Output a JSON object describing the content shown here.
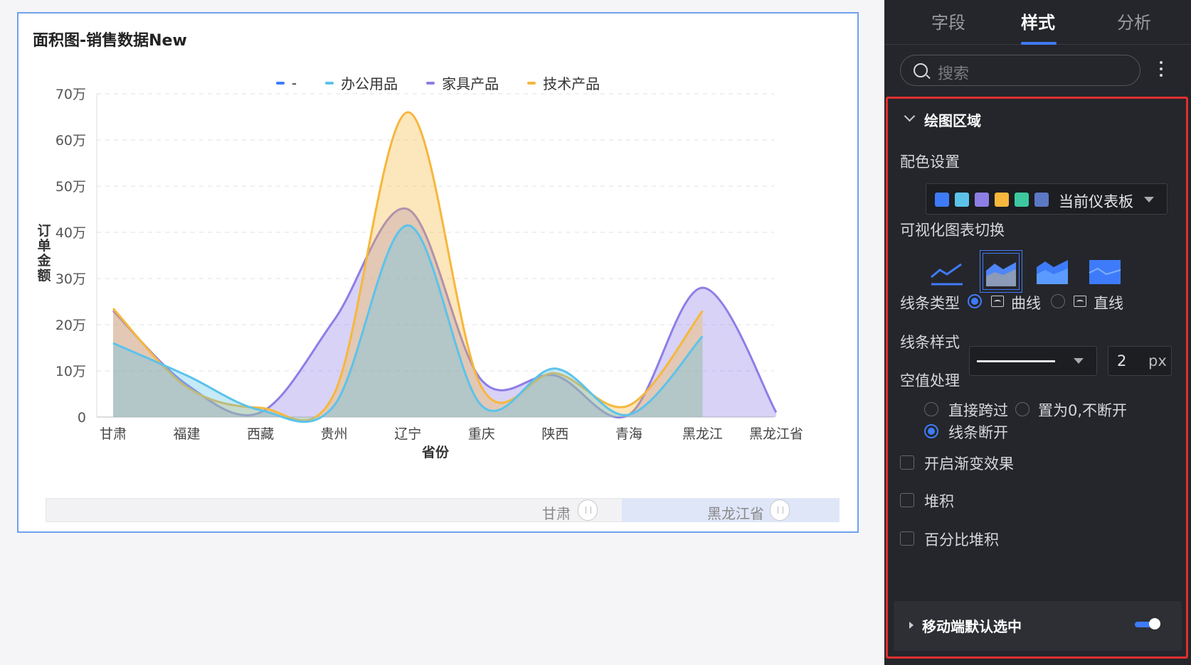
{
  "card": {
    "title": "面积图-销售数据New"
  },
  "legend": [
    {
      "label": "-",
      "color": "#3e7bfa"
    },
    {
      "label": "办公用品",
      "color": "#5bc3ea"
    },
    {
      "label": "家具产品",
      "color": "#8d7ee6"
    },
    {
      "label": "技术产品",
      "color": "#f6b73c"
    }
  ],
  "chart_data": {
    "type": "area",
    "title": "面积图-销售数据New",
    "xlabel": "省份",
    "ylabel": "订单金额",
    "categories": [
      "甘肃",
      "福建",
      "西藏",
      "贵州",
      "辽宁",
      "重庆",
      "陕西",
      "青海",
      "黑龙江",
      "黑龙江省"
    ],
    "y_ticks": [
      "0",
      "10万",
      "20万",
      "30万",
      "40万",
      "50万",
      "60万",
      "70万"
    ],
    "ylim": [
      0,
      700000
    ],
    "grid": true,
    "legend_position": "top",
    "series": [
      {
        "name": "办公用品",
        "color": "#5bc3ea",
        "values": [
          160000,
          90000,
          15000,
          25000,
          415000,
          25000,
          105000,
          5000,
          175000,
          null
        ]
      },
      {
        "name": "家具产品",
        "color": "#8d7ee6",
        "values": [
          230000,
          70000,
          10000,
          210000,
          450000,
          80000,
          90000,
          5000,
          280000,
          10000
        ]
      },
      {
        "name": "技术产品",
        "color": "#f6b73c",
        "values": [
          235000,
          65000,
          20000,
          50000,
          660000,
          65000,
          95000,
          25000,
          230000,
          null
        ]
      }
    ]
  },
  "slider": {
    "start_label": "甘肃",
    "end_label": "黑龙江省"
  },
  "panel": {
    "tabs": [
      "字段",
      "样式",
      "分析"
    ],
    "active_tab": "样式",
    "search_placeholder": "搜索",
    "section_title": "绘图区域",
    "color_label": "配色设置",
    "palette": [
      "#3e7bfa",
      "#5bc3ea",
      "#8d7ee6",
      "#f6b73c",
      "#3cc9a0",
      "#5b78c4"
    ],
    "palette_name": "当前仪表板",
    "switch_label": "可视化图表切换",
    "line_type_label": "线条类型",
    "curve_label": "曲线",
    "straight_label": "直线",
    "line_style_label": "线条样式",
    "line_width": "2",
    "line_width_unit": "px",
    "null_label": "空值处理",
    "null_skip": "直接跨过",
    "null_zero": "置为0,不断开",
    "null_break": "线条断开",
    "gradient_label": "开启渐变效果",
    "stack_label": "堆积",
    "percent_stack_label": "百分比堆积",
    "mobile_label": "移动端默认选中"
  }
}
